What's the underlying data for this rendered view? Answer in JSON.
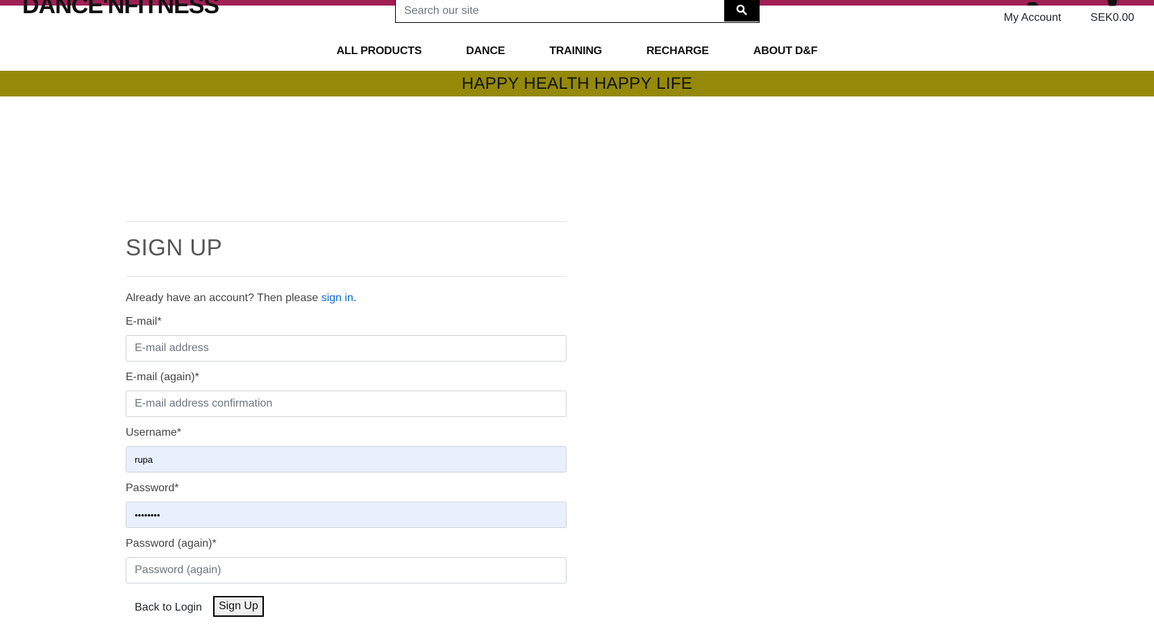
{
  "colors": {
    "top_strip": "#a01f55",
    "banner_bg": "#948909",
    "link": "#0a6ad6",
    "autofill_bg": "#e8f0fe"
  },
  "header": {
    "logo_text": "DANCE'NFITNESS",
    "search": {
      "placeholder": "Search our site",
      "icon": "search-icon"
    },
    "account": {
      "label": "My Account",
      "icon": "user-icon"
    },
    "bag": {
      "label": "SEK0.00",
      "icon": "shopping-bag-icon"
    }
  },
  "nav": {
    "items": [
      {
        "label": "ALL PRODUCTS"
      },
      {
        "label": "DANCE"
      },
      {
        "label": "TRAINING"
      },
      {
        "label": "RECHARGE"
      },
      {
        "label": "ABOUT D&F"
      }
    ]
  },
  "banner": {
    "text": "HAPPY HEALTH HAPPY LIFE"
  },
  "signup": {
    "title": "SIGN UP",
    "intro_prefix": "Already have an account? Then please ",
    "intro_link": "sign in",
    "intro_suffix": ".",
    "fields": {
      "email": {
        "label": "E-mail*",
        "placeholder": "E-mail address",
        "value": ""
      },
      "email2": {
        "label": "E-mail (again)*",
        "placeholder": "E-mail address confirmation",
        "value": ""
      },
      "username": {
        "label": "Username*",
        "placeholder": "",
        "value": "rupa"
      },
      "password": {
        "label": "Password*",
        "placeholder": "",
        "value": "••••••••"
      },
      "password2": {
        "label": "Password (again)*",
        "placeholder": "Password (again)",
        "value": ""
      }
    },
    "back_label": "Back to Login",
    "submit_label": "Sign Up"
  }
}
